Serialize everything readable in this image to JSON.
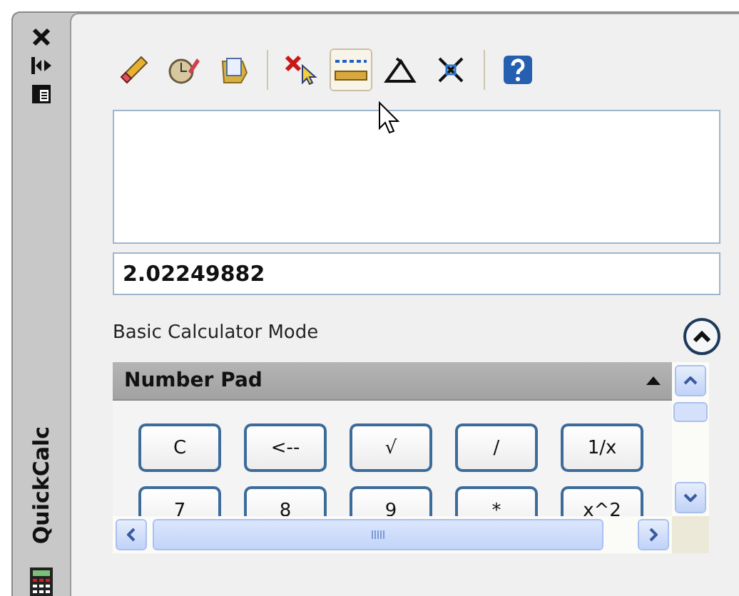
{
  "side_bar": {
    "title": "QuickCalc"
  },
  "toolbar": [
    {
      "kind": "clear",
      "hovered": false
    },
    {
      "kind": "history",
      "hovered": false
    },
    {
      "kind": "paste",
      "hovered": false
    },
    {
      "kind": "separator"
    },
    {
      "kind": "pick",
      "hovered": false
    },
    {
      "kind": "distance",
      "hovered": true
    },
    {
      "kind": "angle",
      "hovered": false
    },
    {
      "kind": "intersect",
      "hovered": false
    },
    {
      "kind": "separator"
    },
    {
      "kind": "help",
      "hovered": false
    }
  ],
  "input": {
    "value": "2.02249882"
  },
  "mode": {
    "label": "Basic Calculator Mode",
    "expanded": true
  },
  "number_pad": {
    "title": "Number Pad",
    "expanded": true,
    "rows": [
      [
        "C",
        "<--",
        "√",
        "/",
        "1/x"
      ],
      [
        "7",
        "8",
        "9",
        "*",
        "x^2"
      ]
    ]
  }
}
